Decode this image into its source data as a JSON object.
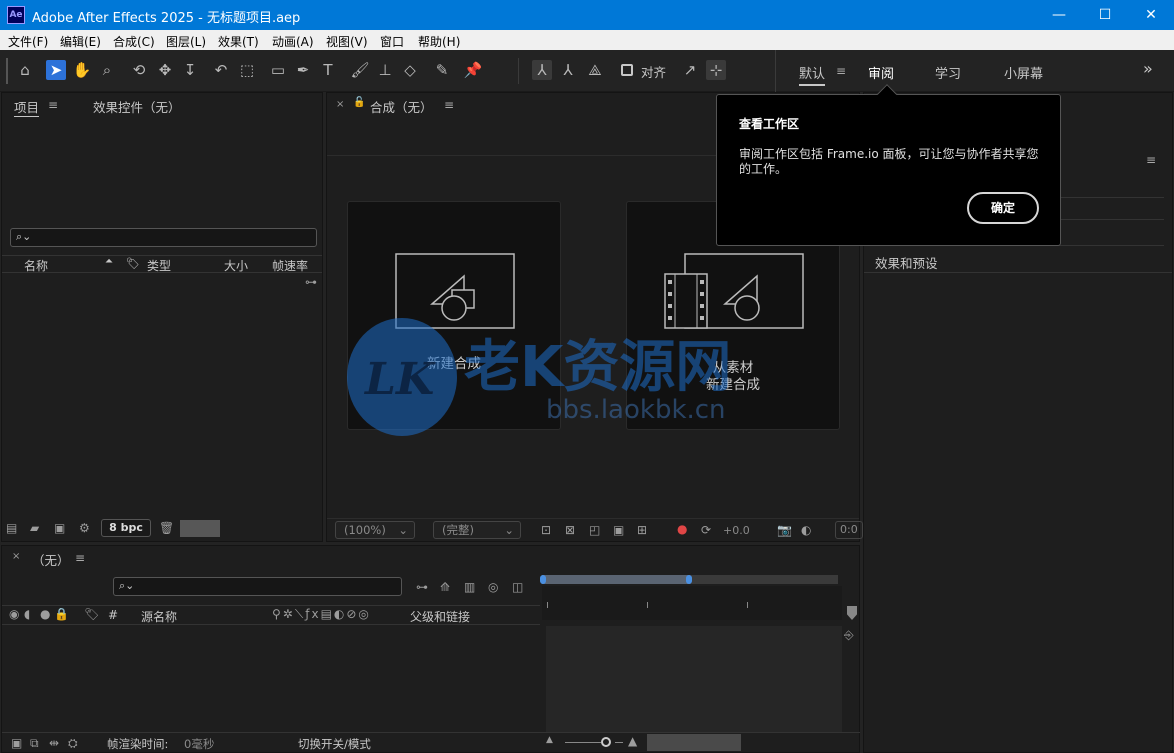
{
  "window": {
    "app_icon": "Ae",
    "title": "Adobe After Effects 2025 - 无标题项目.aep",
    "minimize": "—",
    "maximize": "☐",
    "close": "✕"
  },
  "menu": [
    "文件(F)",
    "编辑(E)",
    "合成(C)",
    "图层(L)",
    "效果(T)",
    "动画(A)",
    "视图(V)",
    "窗口",
    "帮助(H)"
  ],
  "toolbar": {
    "snap_label": "对齐"
  },
  "workspace": {
    "tabs": [
      "默认",
      "审阅",
      "学习",
      "小屏幕"
    ],
    "more": "»"
  },
  "project_panel": {
    "tabs": [
      "项目",
      "效果控件（无）"
    ],
    "columns": [
      "名称",
      "类型",
      "大小",
      "帧速率"
    ],
    "bpc": "8 bpc"
  },
  "comp_panel": {
    "tab": "合成（无）",
    "cards": [
      {
        "label": "新建合成"
      },
      {
        "label_line1": "从素材",
        "label_line2": "新建合成"
      }
    ],
    "zoom": "(100%)",
    "quality": "(完整)",
    "exposure": "+0.0",
    "timecode": "0:0"
  },
  "popup": {
    "title": "查看工作区",
    "body": "审阅工作区包括 Frame.io 面板，可让您与协作者共享您的工作。",
    "ok": "确定"
  },
  "right_panel": {
    "effects_presets": "效果和预设"
  },
  "timeline": {
    "tab": "（无）",
    "columns": {
      "hash": "#",
      "source_name": "源名称",
      "parent": "父级和链接"
    },
    "render_time_label": "帧渲染时间:",
    "render_time_value": "0毫秒",
    "toggle_label": "切换开关/模式"
  },
  "watermark": {
    "text": "老K资源网",
    "url": "bbs.laokbk.cn",
    "logo": "LK"
  },
  "colors": {
    "titlebar": "#0078d7",
    "accent": "#2d72d9",
    "panel_bg": "#1e1e1e"
  }
}
